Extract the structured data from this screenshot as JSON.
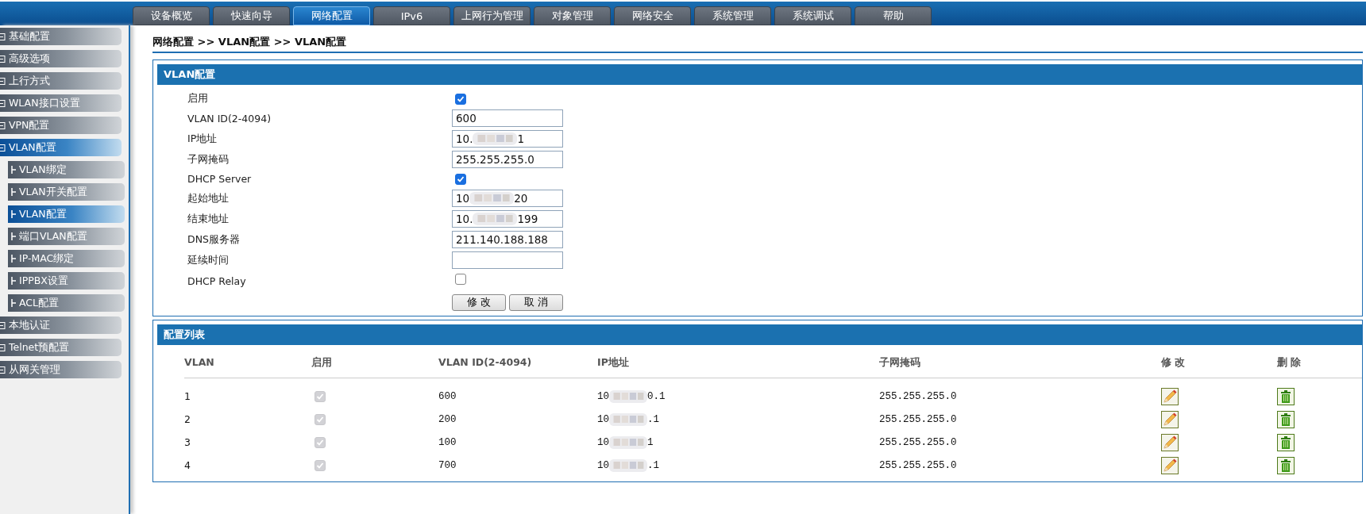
{
  "top_tabs": [
    {
      "label": "设备概览",
      "selected": false
    },
    {
      "label": "快速向导",
      "selected": false
    },
    {
      "label": "网络配置",
      "selected": true
    },
    {
      "label": "IPv6",
      "selected": false
    },
    {
      "label": "上网行为管理",
      "selected": false
    },
    {
      "label": "对象管理",
      "selected": false
    },
    {
      "label": "网络安全",
      "selected": false
    },
    {
      "label": "系统管理",
      "selected": false
    },
    {
      "label": "系统调试",
      "selected": false
    },
    {
      "label": "帮助",
      "selected": false
    }
  ],
  "sidebar": {
    "items": [
      {
        "label": "基础配置",
        "selected": false
      },
      {
        "label": "高级选项",
        "selected": false
      },
      {
        "label": "上行方式",
        "selected": false
      },
      {
        "label": "WLAN接口设置",
        "selected": false
      },
      {
        "label": "VPN配置",
        "selected": false
      },
      {
        "label": "VLAN配置",
        "selected": true,
        "children": [
          {
            "label": "VLAN绑定",
            "selected": false
          },
          {
            "label": "VLAN开关配置",
            "selected": false
          },
          {
            "label": "VLAN配置",
            "selected": true
          },
          {
            "label": "端口VLAN配置",
            "selected": false
          },
          {
            "label": "IP-MAC绑定",
            "selected": false
          },
          {
            "label": "IPPBX设置",
            "selected": false
          },
          {
            "label": "ACL配置",
            "selected": false
          }
        ]
      },
      {
        "label": "本地认证",
        "selected": false
      },
      {
        "label": "Telnet预配置",
        "selected": false
      },
      {
        "label": "从网关管理",
        "selected": false
      }
    ]
  },
  "breadcrumb": "网络配置 >> VLAN配置 >> VLAN配置",
  "form": {
    "title": "VLAN配置",
    "rows": [
      {
        "kind": "checkbox",
        "label": "启用",
        "checked": true
      },
      {
        "kind": "text",
        "label": "VLAN ID(2-4094)",
        "value": "600"
      },
      {
        "kind": "redacted",
        "label": "IP地址",
        "value_start": "10.",
        "value_end": "1"
      },
      {
        "kind": "text",
        "label": "子网掩码",
        "value": "255.255.255.0"
      },
      {
        "kind": "checkbox",
        "label": "DHCP Server",
        "checked": true
      },
      {
        "kind": "redacted",
        "label": "起始地址",
        "value_start": "10",
        "value_end": "20"
      },
      {
        "kind": "redacted",
        "label": "结束地址",
        "value_start": "10.",
        "value_end": "199"
      },
      {
        "kind": "text",
        "label": "DNS服务器",
        "value": "211.140.188.188"
      },
      {
        "kind": "text",
        "label": "延续时间",
        "value": ""
      },
      {
        "kind": "checkbox",
        "label": "DHCP Relay",
        "checked": false
      }
    ],
    "buttons": [
      "修 改",
      "取 消"
    ]
  },
  "table": {
    "title": "配置列表",
    "columns": [
      "VLAN",
      "启用",
      "VLAN ID(2-4094)",
      "IP地址",
      "子网掩码",
      "修 改",
      "删 除"
    ],
    "rows": [
      {
        "vlan": "1",
        "enabled": true,
        "vlan_id": "600",
        "ip_start": "10",
        "ip_end": "0.1",
        "mask": "255.255.255.0"
      },
      {
        "vlan": "2",
        "enabled": true,
        "vlan_id": "200",
        "ip_start": "10",
        "ip_end": ".1",
        "mask": "255.255.255.0"
      },
      {
        "vlan": "3",
        "enabled": true,
        "vlan_id": "100",
        "ip_start": "10",
        "ip_end": "1",
        "mask": "255.255.255.0"
      },
      {
        "vlan": "4",
        "enabled": true,
        "vlan_id": "700",
        "ip_start": "10",
        "ip_end": ".1",
        "mask": "255.255.255.0"
      }
    ]
  }
}
